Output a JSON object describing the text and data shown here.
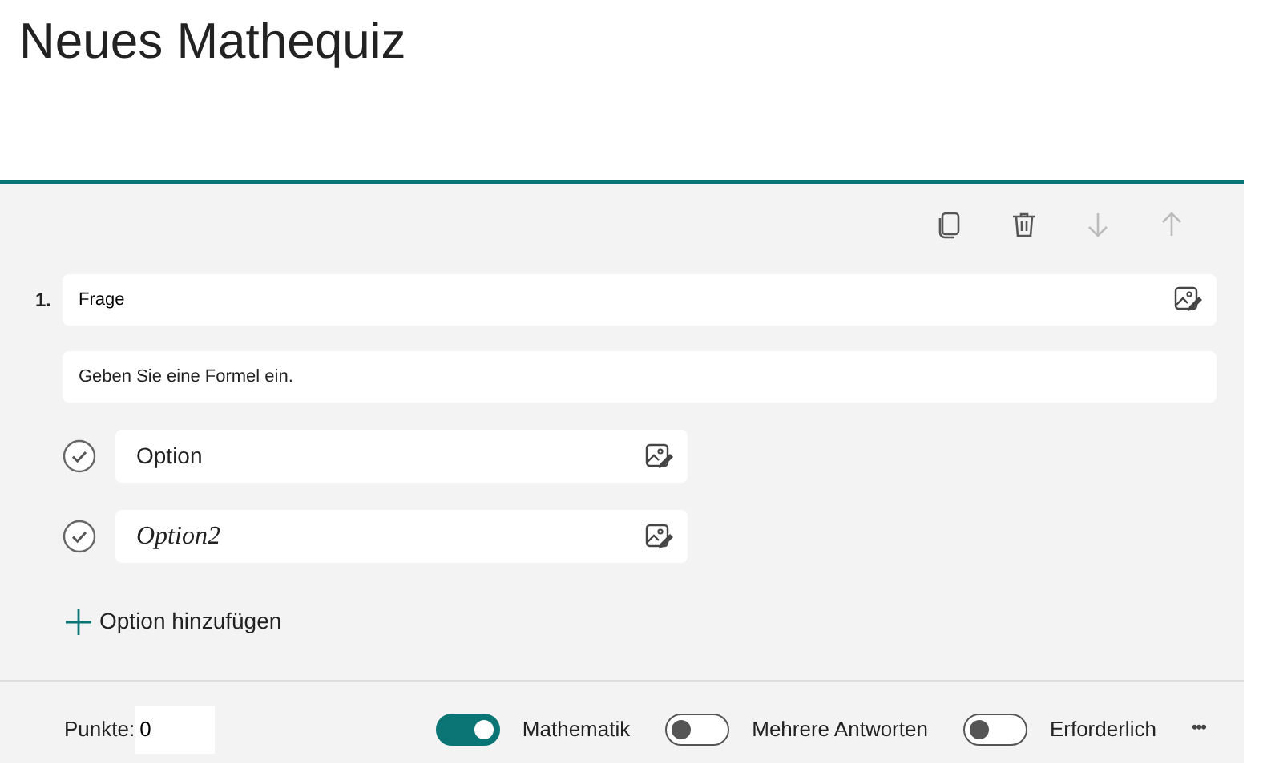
{
  "title": "Neues Mathequiz",
  "toolbar": [
    {
      "kind": "copy",
      "disabled": false
    },
    {
      "kind": "delete",
      "disabled": false
    },
    {
      "kind": "down",
      "disabled": true
    },
    {
      "kind": "up",
      "disabled": true
    }
  ],
  "question": {
    "number": "1.",
    "text": "Frage",
    "formula_placeholder": "Geben Sie eine Formel ein."
  },
  "options": [
    {
      "text": "Option",
      "kind": "text"
    },
    {
      "text": "Option2",
      "kind": "math"
    }
  ],
  "add_option": "Option hinzufügen",
  "footer": {
    "points_label": "Punkte:",
    "points_value": "0",
    "toggles": [
      {
        "label": "Mathematik",
        "on": true
      },
      {
        "label": "Mehrere Antworten",
        "on": false
      },
      {
        "label": "Erforderlich",
        "on": false
      }
    ],
    "more": "•••"
  }
}
